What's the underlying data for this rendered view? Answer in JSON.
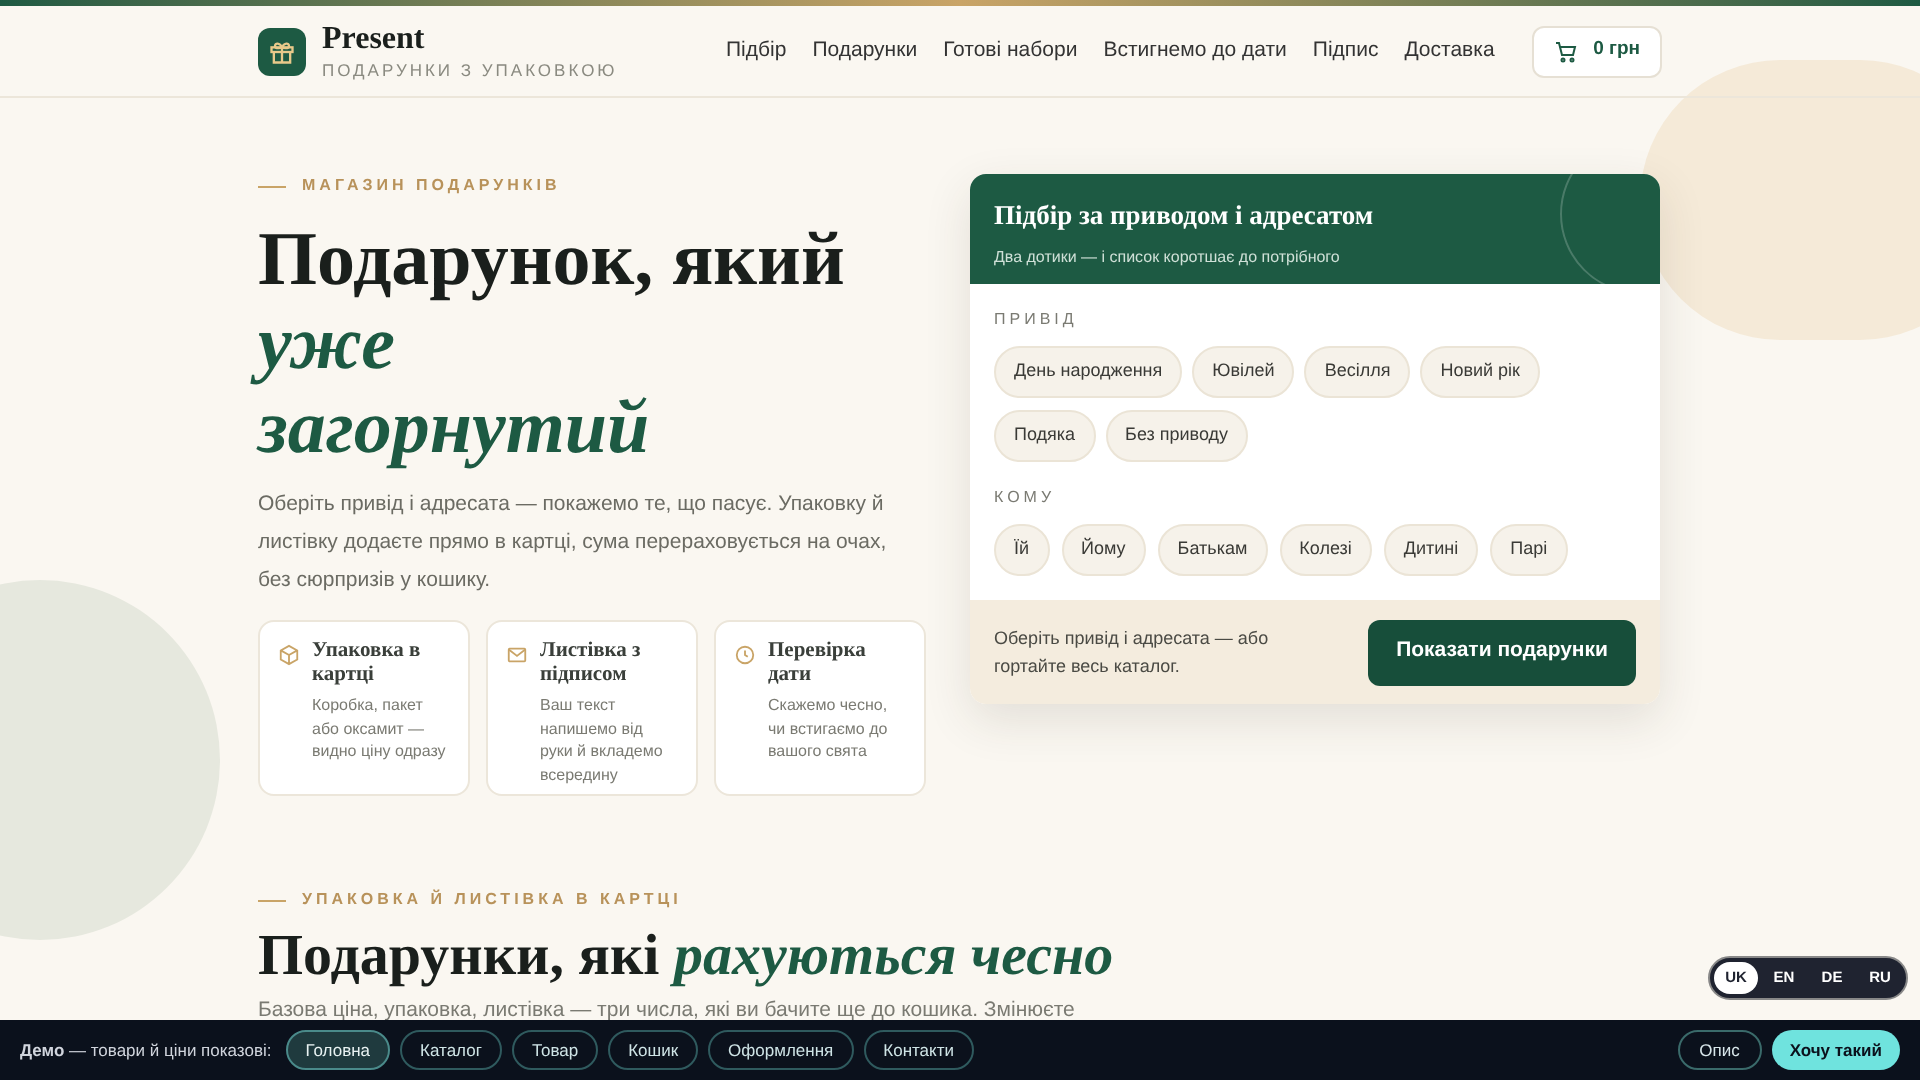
{
  "header": {
    "logo_title": "Present",
    "logo_subtitle": "ПОДАРУНКИ З УПАКОВКОЮ",
    "nav": [
      "Підбір",
      "Подарунки",
      "Готові набори",
      "Встигнемо до дати",
      "Підпис",
      "Доставка"
    ],
    "cart": "0 грн"
  },
  "hero": {
    "eyebrow": "МАГАЗИН ПОДАРУНКІВ",
    "title": "Подарунок, який",
    "title_accent_lines": [
      "уже",
      "загорнутий"
    ],
    "description": "Оберіть привід і адресата — покажемо те, що пасує. Упаковку й листівку додаєте прямо в картці, сума перераховується на очах, без сюрпризів у кошику.",
    "features": [
      {
        "kind": "box",
        "title": "Упаковка в картці",
        "text": "Коробка, пакет або оксамит — видно ціну одразу"
      },
      {
        "kind": "envelope",
        "title": "Листівка з підписом",
        "text": "Ваш текст напишемо від руки й вкладемо всередину"
      },
      {
        "kind": "clock",
        "title": "Перевірка дати",
        "text": "Скажемо чесно, чи встигаємо до вашого свята"
      }
    ]
  },
  "picker": {
    "title": "Підбір за приводом і адресатом",
    "subtitle": "Два дотики — і список коротшає до потрібного",
    "occasion_label": "ПРИВІД",
    "occasions": [
      {
        "label": "День народження",
        "selected": false
      },
      {
        "label": "Ювілей",
        "selected": false
      },
      {
        "label": "Весілля",
        "selected": false
      },
      {
        "label": "Новий рік",
        "selected": false
      },
      {
        "label": "Подяка",
        "selected": false
      },
      {
        "label": "Без приводу",
        "selected": false
      }
    ],
    "recipient_label": "КОМУ",
    "recipients": [
      {
        "label": "Їй",
        "selected": false
      },
      {
        "label": "Йому",
        "selected": false
      },
      {
        "label": "Батькам",
        "selected": false
      },
      {
        "label": "Колезі",
        "selected": false
      },
      {
        "label": "Дитині",
        "selected": false
      },
      {
        "label": "Парі",
        "selected": false
      }
    ],
    "hint": "Оберіть привід і адресата — або гортайте весь каталог.",
    "button": "Показати подарунки"
  },
  "section": {
    "eyebrow": "УПАКОВКА Й ЛИСТІВКА В КАРТЦІ",
    "title": "Подарунки, які",
    "title_accent": "рахуються чесно",
    "description": "Базова ціна, упаковка, листівка — три числа, які ви бачите ще до кошика. Змінюєте"
  },
  "languages": [
    {
      "label": "UK",
      "selected": true
    },
    {
      "label": "EN",
      "selected": false
    },
    {
      "label": "DE",
      "selected": false
    },
    {
      "label": "RU",
      "selected": false
    }
  ],
  "demo_bar": {
    "label": "**Демо** — товари й ціни показові:",
    "pages": [
      {
        "label": "Головна",
        "selected": true
      },
      {
        "label": "Каталог",
        "selected": false
      },
      {
        "label": "Товар",
        "selected": false
      },
      {
        "label": "Кошик",
        "selected": false
      },
      {
        "label": "Оформлення",
        "selected": false
      },
      {
        "label": "Контакти",
        "selected": false
      }
    ],
    "about": "Опис",
    "cta": "Хочу такий"
  }
}
